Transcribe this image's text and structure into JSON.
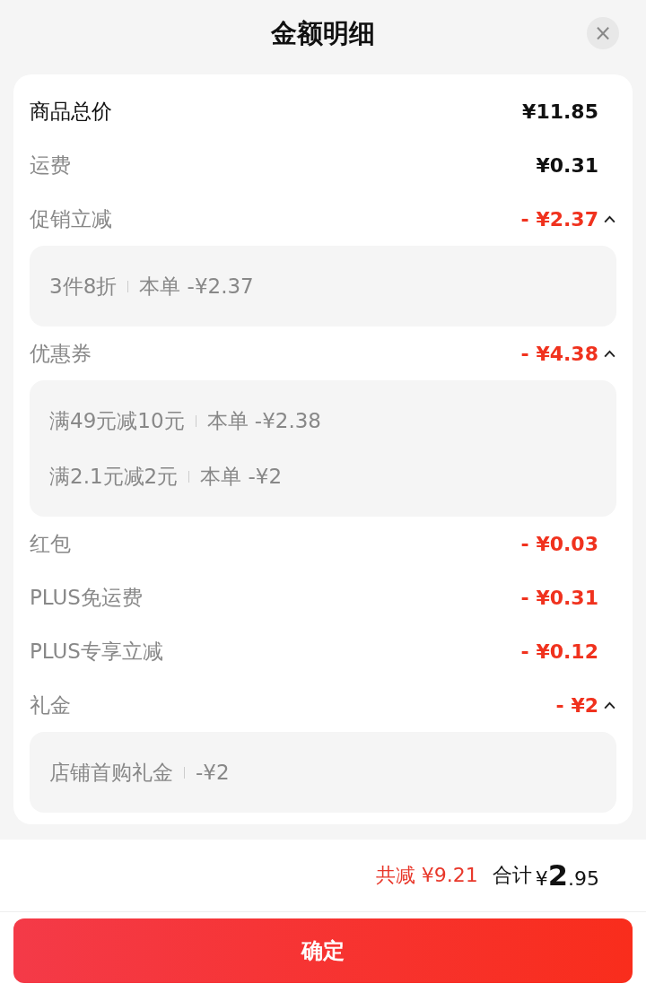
{
  "title": "金额明细",
  "close_button": {
    "label": "×"
  },
  "rows": [
    {
      "kind": "total",
      "label": "商品总价",
      "amount": "¥11.85"
    },
    {
      "kind": "charge",
      "label": "运费",
      "amount": "¥0.31"
    },
    {
      "kind": "discount",
      "label": "促销立减",
      "amount": "- ¥2.37",
      "expanded": true,
      "details": [
        {
          "name": "3件8折",
          "amount": "本单 -¥2.37"
        }
      ]
    },
    {
      "kind": "discount",
      "label": "优惠券",
      "amount": "- ¥4.38",
      "expanded": true,
      "details": [
        {
          "name": "满49元减10元",
          "amount": "本单 -¥2.38"
        },
        {
          "name": "满2.1元减2元",
          "amount": "本单 -¥2"
        }
      ]
    },
    {
      "kind": "discount",
      "label": "红包",
      "amount": "- ¥0.03"
    },
    {
      "kind": "discount",
      "label": "PLUS免运费",
      "amount": "- ¥0.31"
    },
    {
      "kind": "discount",
      "label": "PLUS专享立减",
      "amount": "- ¥0.12"
    },
    {
      "kind": "discount",
      "label": "礼金",
      "amount": "- ¥2",
      "expanded": true,
      "details": [
        {
          "name": "店铺首购礼金",
          "amount": "-¥2"
        }
      ]
    }
  ],
  "summary": {
    "saved": "共减 ¥9.21",
    "total_label": "合计",
    "total": "¥**2**.95"
  },
  "confirm_button": {
    "label": "确定"
  }
}
